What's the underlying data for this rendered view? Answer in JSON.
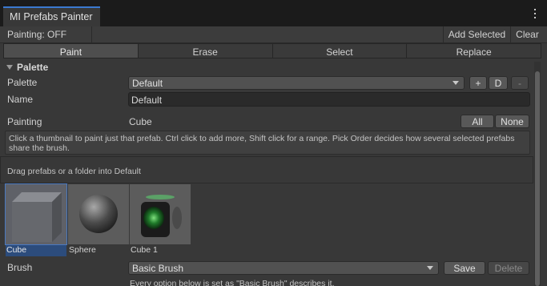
{
  "window": {
    "tab_title": "MI Prefabs Painter"
  },
  "toolbar": {
    "status": "Painting: OFF",
    "add_selected": "Add Selected",
    "clear": "Clear"
  },
  "modes": [
    {
      "label": "Paint",
      "active": true
    },
    {
      "label": "Erase",
      "active": false
    },
    {
      "label": "Select",
      "active": false
    },
    {
      "label": "Replace",
      "active": false
    }
  ],
  "palette_section": {
    "title": "Palette",
    "palette_label": "Palette",
    "palette_value": "Default",
    "add_label": "+",
    "duplicate_label": "D",
    "remove_label": "-",
    "name_label": "Name",
    "name_value": "Default",
    "painting_label": "Painting",
    "painting_value": "Cube",
    "all_label": "All",
    "none_label": "None",
    "help_text": "Click a thumbnail to paint just that prefab. Ctrl click to add more, Shift click for a range. Pick Order decides how several selected prefabs share the brush.",
    "dropzone_text": "Drag prefabs or a folder into Default"
  },
  "prefabs": [
    {
      "name": "Cube",
      "icon": "cube-thumbnail",
      "selected": true
    },
    {
      "name": "Sphere",
      "icon": "sphere-thumbnail",
      "selected": false
    },
    {
      "name": "Cube 1",
      "icon": "green-cube-thumbnail",
      "selected": false
    }
  ],
  "brush": {
    "label": "Brush",
    "value": "Basic Brush",
    "save_label": "Save",
    "delete_label": "Delete",
    "hint": "Every option below is set as \"Basic Brush\" describes it."
  },
  "colors": {
    "accent": "#3a79d0",
    "selection": "#2c4c7c",
    "panel": "#383838"
  }
}
